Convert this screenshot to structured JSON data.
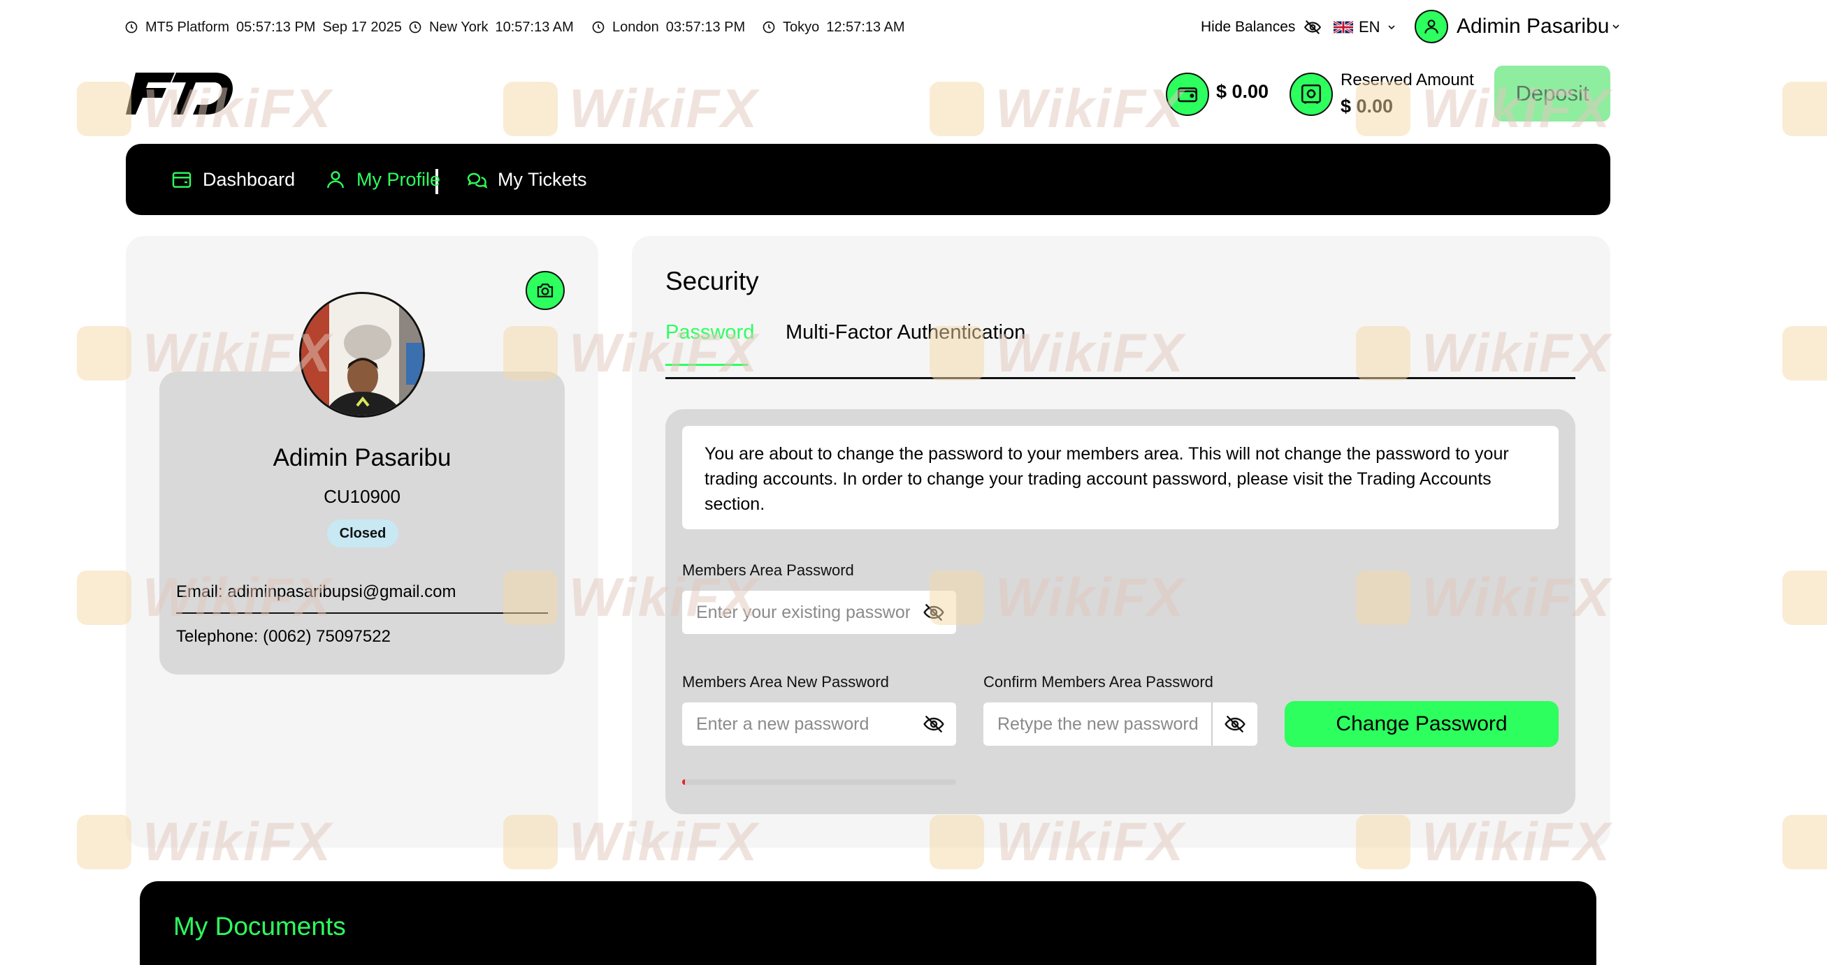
{
  "topbar": {
    "clocks": [
      {
        "label": "MT5 Platform",
        "time": "05:57:13 PM",
        "date": "Sep 17 2025"
      },
      {
        "label": "New York",
        "time": "10:57:13 AM"
      },
      {
        "label": "London",
        "time": "03:57:13 PM"
      },
      {
        "label": "Tokyo",
        "time": "12:57:13 AM"
      }
    ],
    "hide_balances": "Hide Balances",
    "language": "EN",
    "user_name": "Adimin Pasaribu"
  },
  "header": {
    "wallet_balance": "$ 0.00",
    "reserved_label": "Reserved Amount",
    "reserved_value": "$ 0.00",
    "deposit_label": "Deposit"
  },
  "nav": {
    "items": [
      {
        "label": "Dashboard",
        "active": false
      },
      {
        "label": "My Profile",
        "active": true
      },
      {
        "label": "My Tickets",
        "active": false
      }
    ]
  },
  "profile": {
    "name": "Adimin Pasaribu",
    "client_id": "CU10900",
    "status": "Closed",
    "email": "Email: adiminpasaribupsi@gmail.com",
    "telephone": "Telephone: (0062) 75097522"
  },
  "security": {
    "title": "Security",
    "tabs": [
      {
        "label": "Password",
        "active": true
      },
      {
        "label": "Multi-Factor Authentication",
        "active": false
      }
    ],
    "notice": "You are about to change the password to your members area. This will not change the password to your trading accounts. In order to change your trading account password, please visit the Trading Accounts section.",
    "current_label": "Members Area Password",
    "current_placeholder": "Enter your existing password",
    "new_label": "Members Area New Password",
    "new_placeholder": "Enter a new password",
    "confirm_label": "Confirm Members Area Password",
    "confirm_placeholder": "Retype the new password",
    "change_button": "Change Password",
    "strength_fraction": 0.01
  },
  "documents": {
    "title": "My Documents"
  },
  "watermark": "WikiFX",
  "colors": {
    "accent": "#2dff5f",
    "nav_bg": "#000000",
    "panel_bg": "#f5f5f5",
    "card_bg": "#d9d9d9",
    "status_badge": "#c8e8f3",
    "deposit_disabled": "#8eed9f",
    "strength_weak": "#e8242c"
  }
}
